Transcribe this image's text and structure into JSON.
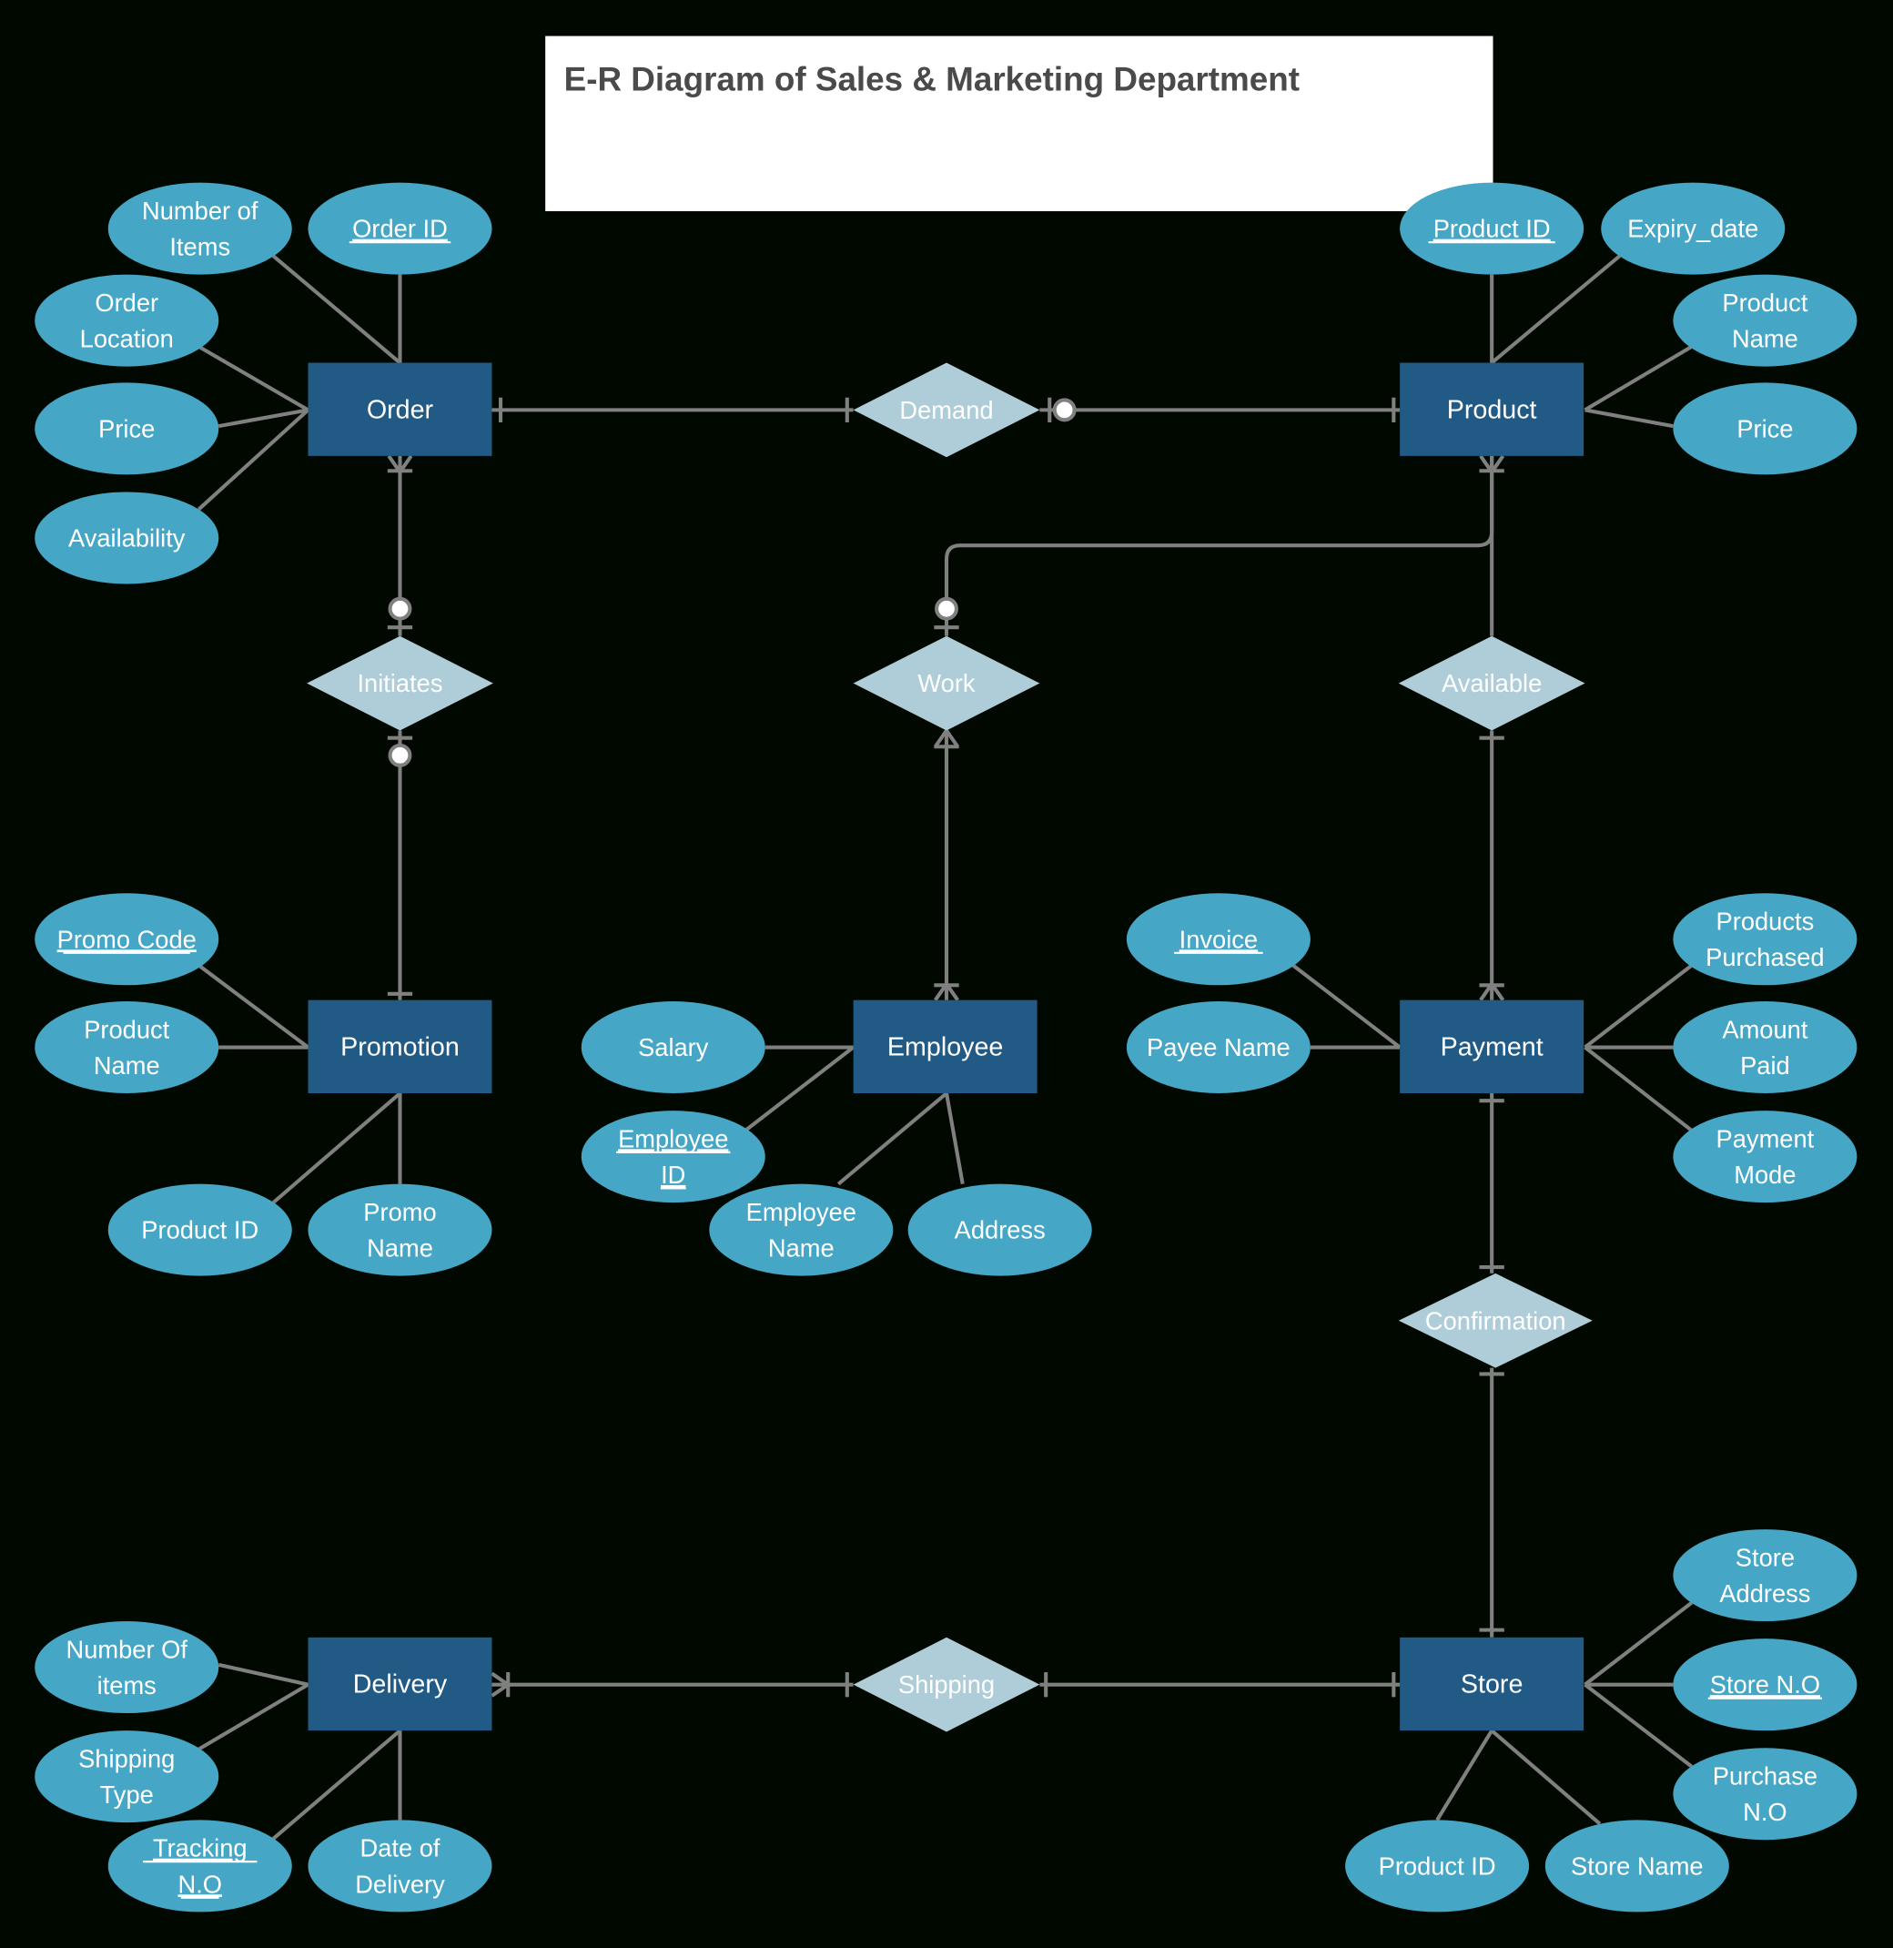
{
  "title": "E-R Diagram of Sales & Marketing Department",
  "colors": {
    "background": "#000800",
    "entity": "#215a85",
    "attribute": "#45a6c6",
    "relationship": "#aecdd9",
    "connector": "#808080",
    "title_box": "#ffffff",
    "title_text": "#4a4a4a"
  },
  "entities": [
    {
      "id": "order",
      "label": "Order",
      "attributes": [
        {
          "label": "Number of Items",
          "lines": [
            "Number of",
            "Items"
          ],
          "key": false
        },
        {
          "label": "Order ID",
          "lines": [
            "Order ID"
          ],
          "key": true
        },
        {
          "label": "Order Location",
          "lines": [
            "Order",
            "Location"
          ],
          "key": false
        },
        {
          "label": "Price",
          "lines": [
            "Price"
          ],
          "key": false
        },
        {
          "label": "Availability",
          "lines": [
            "Availability"
          ],
          "key": false
        }
      ]
    },
    {
      "id": "product",
      "label": "Product",
      "attributes": [
        {
          "label": "Product ID",
          "lines": [
            "Product ID"
          ],
          "key": true
        },
        {
          "label": "Expiry_date",
          "lines": [
            "Expiry_date"
          ],
          "key": false
        },
        {
          "label": "Product Name",
          "lines": [
            "Product",
            "Name"
          ],
          "key": false
        },
        {
          "label": "Price",
          "lines": [
            "Price"
          ],
          "key": false
        }
      ]
    },
    {
      "id": "promotion",
      "label": "Promotion",
      "attributes": [
        {
          "label": "Promo Code",
          "lines": [
            "Promo Code"
          ],
          "key": true
        },
        {
          "label": "Product Name",
          "lines": [
            "Product",
            "Name"
          ],
          "key": false
        },
        {
          "label": "Product ID",
          "lines": [
            "Product ID"
          ],
          "key": false
        },
        {
          "label": "Promo Name",
          "lines": [
            "Promo",
            "Name"
          ],
          "key": false
        }
      ]
    },
    {
      "id": "employee",
      "label": "Employee",
      "attributes": [
        {
          "label": "Salary",
          "lines": [
            "Salary"
          ],
          "key": false
        },
        {
          "label": "Employee ID",
          "lines": [
            "Employee ",
            "ID"
          ],
          "key": true
        },
        {
          "label": "Employee Name",
          "lines": [
            "Employee",
            "Name"
          ],
          "key": false
        },
        {
          "label": "Address",
          "lines": [
            "Address"
          ],
          "key": false
        }
      ]
    },
    {
      "id": "payment",
      "label": "Payment",
      "attributes": [
        {
          "label": "Invoice",
          "lines": [
            "Invoice"
          ],
          "key": true
        },
        {
          "label": "Payee Name",
          "lines": [
            "Payee Name"
          ],
          "key": false
        },
        {
          "label": "Products Purchased",
          "lines": [
            "Products",
            "Purchased"
          ],
          "key": false
        },
        {
          "label": "Amount Paid",
          "lines": [
            "Amount",
            "Paid"
          ],
          "key": false
        },
        {
          "label": "Payment Mode",
          "lines": [
            "Payment",
            "Mode"
          ],
          "key": false
        }
      ]
    },
    {
      "id": "delivery",
      "label": "Delivery",
      "attributes": [
        {
          "label": "Number Of items",
          "lines": [
            "Number Of",
            "items"
          ],
          "key": false
        },
        {
          "label": "Shipping Type",
          "lines": [
            "Shipping",
            "Type"
          ],
          "key": false
        },
        {
          "label": "Tracking N.O",
          "lines": [
            "Tracking ",
            "N.O"
          ],
          "key": true
        },
        {
          "label": "Date of Delivery",
          "lines": [
            "Date of",
            "Delivery"
          ],
          "key": false
        }
      ]
    },
    {
      "id": "store",
      "label": "Store",
      "attributes": [
        {
          "label": "Store Address",
          "lines": [
            "Store",
            "Address"
          ],
          "key": false
        },
        {
          "label": "Store N.O",
          "lines": [
            "Store N.O"
          ],
          "key": true
        },
        {
          "label": "Purchase N.O",
          "lines": [
            "Purchase",
            "N.O"
          ],
          "key": false
        },
        {
          "label": "Product ID",
          "lines": [
            "Product ID"
          ],
          "key": false
        },
        {
          "label": "Store Name",
          "lines": [
            "Store Name"
          ],
          "key": false
        }
      ]
    }
  ],
  "relationships": [
    {
      "id": "demand",
      "label": "Demand",
      "from": "order",
      "to": "product",
      "from_cardinality": "one",
      "to_cardinality": "zero-or-one"
    },
    {
      "id": "initiates",
      "label": "Initiates",
      "from": "order",
      "to": "promotion",
      "from_cardinality": "one-or-many / zero-or-one",
      "to_cardinality": "zero-or-one / one"
    },
    {
      "id": "work",
      "label": "Work",
      "from": "product",
      "to": "employee",
      "from_cardinality": "one-or-many / zero-or-one",
      "to_cardinality": "one-or-many"
    },
    {
      "id": "available",
      "label": "Available",
      "from": "product",
      "to": "payment",
      "from_cardinality": "one-or-many",
      "to_cardinality": "one-or-many"
    },
    {
      "id": "confirmation",
      "label": "Confirmation",
      "from": "payment",
      "to": "store",
      "from_cardinality": "one",
      "to_cardinality": "one"
    },
    {
      "id": "shipping",
      "label": "Shipping",
      "from": "delivery",
      "to": "store",
      "from_cardinality": "one-or-many",
      "to_cardinality": "one"
    }
  ]
}
